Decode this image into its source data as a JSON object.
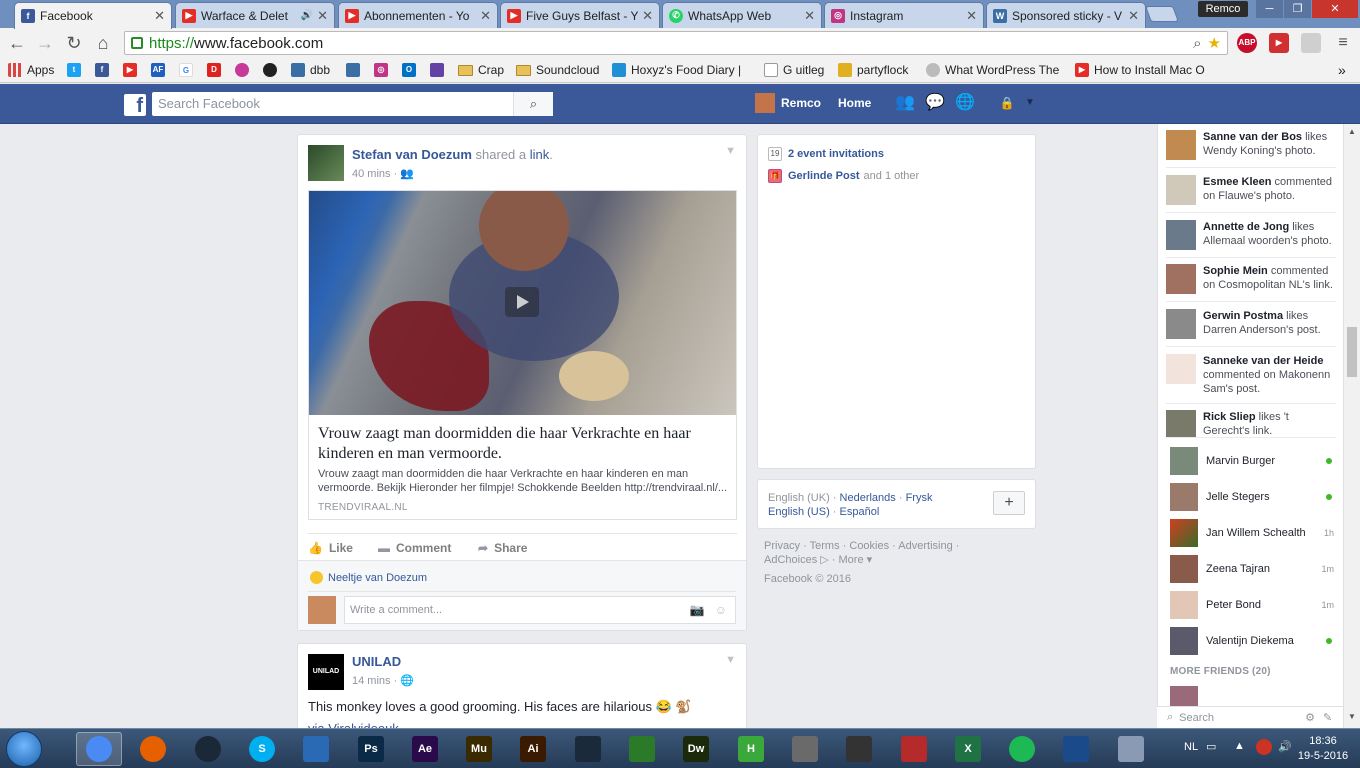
{
  "browser": {
    "tabs": [
      {
        "label": "Facebook",
        "icon": "facebook-favicon",
        "color": "#3b5998",
        "active": true
      },
      {
        "label": "Warface & Delet",
        "icon": "youtube-favicon",
        "color": "#e52d27",
        "active": false
      },
      {
        "label": "Abonnementen - Yo",
        "icon": "youtube-favicon",
        "color": "#e52d27",
        "active": false
      },
      {
        "label": "Five Guys Belfast - Y",
        "icon": "youtube-favicon",
        "color": "#e52d27",
        "active": false
      },
      {
        "label": "WhatsApp Web",
        "icon": "whatsapp-favicon",
        "color": "#25d366",
        "active": false
      },
      {
        "label": "Instagram",
        "icon": "instagram-favicon",
        "color": "#c13584",
        "active": false
      },
      {
        "label": "Sponsored sticky - V",
        "icon": "wordpress-favicon",
        "color": "#3a6ea5",
        "active": false
      }
    ],
    "profile_name": "Remco",
    "url_scheme": "https://",
    "url_host": "www.facebook.com",
    "bookmarks": [
      {
        "label": "Apps",
        "icon": "apps-grid-icon"
      },
      {
        "label": "dbb",
        "icon": "bookmark-icon"
      },
      {
        "label": "Crap",
        "icon": "folder-icon"
      },
      {
        "label": "Soundcloud",
        "icon": "folder-icon"
      },
      {
        "label": "Hoxyz's Food Diary | ",
        "icon": "bookmark-icon"
      },
      {
        "label": "G uitleg",
        "icon": "page-icon"
      },
      {
        "label": "partyflock",
        "icon": "partyflock-icon"
      },
      {
        "label": "What WordPress The",
        "icon": "search-icon"
      },
      {
        "label": "How to Install Mac O",
        "icon": "youtube-favicon"
      }
    ],
    "overflow_label": "»"
  },
  "fb_header": {
    "logo": "f",
    "search_placeholder": "Search Facebook",
    "user_name": "Remco",
    "home_label": "Home"
  },
  "post1": {
    "actor": "Stefan van Doezum",
    "action": " shared a ",
    "action_link": "link",
    "action_end": ".",
    "time": "40 mins",
    "privacy_sep": " · ",
    "link_title": "Vrouw zaagt man doormidden die haar Verkrachte en haar kinderen en man vermoorde.",
    "link_desc": "Vrouw zaagt man doormidden die haar Verkrachte en haar kinderen en man vermoorde. Bekijk Hieronder her filmpje! Schokkende Beelden http://trendviraal.nl/...",
    "link_source": "TRENDVIRAAL.NL",
    "like_label": "Like",
    "comment_label": "Comment",
    "share_label": "Share",
    "reactor": "Neeltje van Doezum",
    "comment_placeholder": "Write a comment..."
  },
  "post2": {
    "actor": "UNILAD",
    "logo_text": "UNILAD",
    "time": "14 mins",
    "privacy_sep": " · ",
    "text": "This monkey loves a good grooming. His faces are hilarious 😂 🐒",
    "via": "via Viralvideouk"
  },
  "right_col": {
    "events": "2 event invitations",
    "birthday_name": "Gerlinde Post",
    "birthday_rest": "and 1 other",
    "languages": [
      {
        "label": "English (UK)",
        "current": true
      },
      {
        "label": "Nederlands",
        "current": false
      },
      {
        "label": "Frysk",
        "current": false
      },
      {
        "label": "English (US)",
        "current": false
      },
      {
        "label": "Español",
        "current": false
      }
    ],
    "plus_label": "+",
    "footer_links": [
      "Privacy",
      "Terms",
      "Cookies",
      "Advertising",
      "AdChoices",
      "More"
    ],
    "copyright": "Facebook © 2016"
  },
  "ticker": [
    {
      "name": "Sanne van der Bos",
      "text": " likes Wendy Koning's photo."
    },
    {
      "name": "Esmee Kleen",
      "text": " commented on Flauwe's photo."
    },
    {
      "name": "Annette de Jong",
      "text": " likes Allemaal woorden's photo."
    },
    {
      "name": "Sophie Mein",
      "text": " commented on Cosmopolitan NL's link."
    },
    {
      "name": "Gerwin Postma",
      "text": " likes Darren Anderson's post."
    },
    {
      "name": "Sanneke van der Heide",
      "text": " commented on Makonenn Sam's post."
    },
    {
      "name": "Rick Sliep",
      "text": " likes 't Gerecht's link."
    }
  ],
  "buddies": [
    {
      "name": "Marvin Burger",
      "status": "online",
      "idle": ""
    },
    {
      "name": "Jelle Stegers",
      "status": "online",
      "idle": ""
    },
    {
      "name": "Jan Willem Schealth",
      "status": "idle",
      "idle": "1h"
    },
    {
      "name": "Zeena Tajran",
      "status": "idle",
      "idle": "1m"
    },
    {
      "name": "Peter Bond",
      "status": "idle",
      "idle": "1m"
    },
    {
      "name": "Valentijn Diekema",
      "status": "online",
      "idle": ""
    }
  ],
  "more_friends": "MORE FRIENDS (20)",
  "chat_search_placeholder": "Search",
  "taskbar": {
    "apps": [
      {
        "icon": "chrome-icon",
        "label": "",
        "color": "#4a8af4",
        "open": true
      },
      {
        "icon": "firefox-icon",
        "label": "",
        "color": "#e66000",
        "open": false
      },
      {
        "icon": "steam-icon",
        "label": "",
        "color": "#1b2838",
        "open": false
      },
      {
        "icon": "skype-icon",
        "label": "S",
        "color": "#00aff0",
        "open": false
      },
      {
        "icon": "remote-desktop-icon",
        "label": "",
        "color": "#2a6ab5",
        "open": false
      },
      {
        "icon": "photoshop-icon",
        "label": "Ps",
        "color": "#0b2a47",
        "open": false
      },
      {
        "icon": "after-effects-icon",
        "label": "Ae",
        "color": "#2a0a4a",
        "open": false
      },
      {
        "icon": "muse-icon",
        "label": "Mu",
        "color": "#3a2a00",
        "open": false
      },
      {
        "icon": "illustrator-icon",
        "label": "Ai",
        "color": "#3a1a00",
        "open": false
      },
      {
        "icon": "video-editor-icon",
        "label": "",
        "color": "#1b2a3a",
        "open": false
      },
      {
        "icon": "camtasia-icon",
        "label": "",
        "color": "#2a7a2a",
        "open": false
      },
      {
        "icon": "dreamweaver-icon",
        "label": "Dw",
        "color": "#1a2a0a",
        "open": false
      },
      {
        "icon": "hamachi-icon",
        "label": "H",
        "color": "#3aa83a",
        "open": false
      },
      {
        "icon": "screen-tool-icon",
        "label": "",
        "color": "#6a6a6a",
        "open": false
      },
      {
        "icon": "racing-icon",
        "label": "",
        "color": "#333333",
        "open": false
      },
      {
        "icon": "game-icon",
        "label": "",
        "color": "#b52a2a",
        "open": false
      },
      {
        "icon": "excel-icon",
        "label": "X",
        "color": "#1f7244",
        "open": false
      },
      {
        "icon": "spotify-icon",
        "label": "",
        "color": "#1db954",
        "open": false
      },
      {
        "icon": "app-icon",
        "label": "",
        "color": "#1a4a8a",
        "open": false
      },
      {
        "icon": "calculator-icon",
        "label": "",
        "color": "#8a9ab5",
        "open": false
      }
    ],
    "language": "NL",
    "time": "18:36",
    "date": "19-5-2016"
  }
}
